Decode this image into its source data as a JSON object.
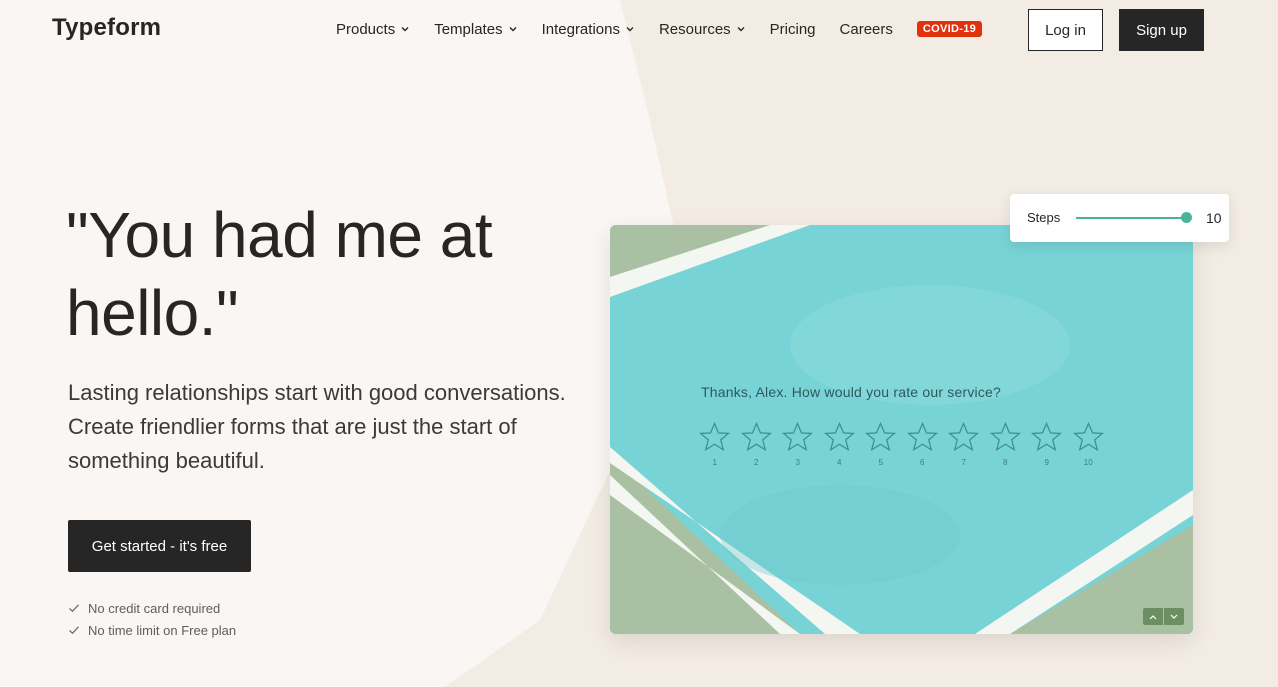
{
  "header": {
    "logo": "Typeform",
    "nav": [
      {
        "label": "Products",
        "dropdown": true
      },
      {
        "label": "Templates",
        "dropdown": true
      },
      {
        "label": "Integrations",
        "dropdown": true
      },
      {
        "label": "Resources",
        "dropdown": true
      },
      {
        "label": "Pricing",
        "dropdown": false
      },
      {
        "label": "Careers",
        "dropdown": false
      }
    ],
    "badge": "COVID-19",
    "login": "Log in",
    "signup": "Sign up"
  },
  "hero": {
    "headline": "\"You had me at hello.\"",
    "subtext": "Lasting relationships start with good conversations. Create friendlier forms that are just the start of something beautiful.",
    "cta": "Get started - it's free",
    "checks": [
      "No credit card required",
      "No time limit on Free plan"
    ]
  },
  "preview": {
    "question": "Thanks, Alex. How would you rate our service?",
    "stars": [
      "1",
      "2",
      "3",
      "4",
      "5",
      "6",
      "7",
      "8",
      "9",
      "10"
    ]
  },
  "steps": {
    "label": "Steps",
    "value": "10",
    "level": 1.0
  },
  "colors": {
    "page_bg": "#f9f6f3",
    "accent_bg": "#f3ece4",
    "dark": "#262627",
    "badge": "#e0320e",
    "card_teal": "#76d4d6",
    "card_sage": "#a9c0a3",
    "slider": "#49b49a"
  },
  "icons": {
    "chevron": "chevron-down-icon",
    "check": "check-icon",
    "star": "star-outline-icon",
    "up": "arrow-up-icon",
    "down": "arrow-down-icon"
  }
}
